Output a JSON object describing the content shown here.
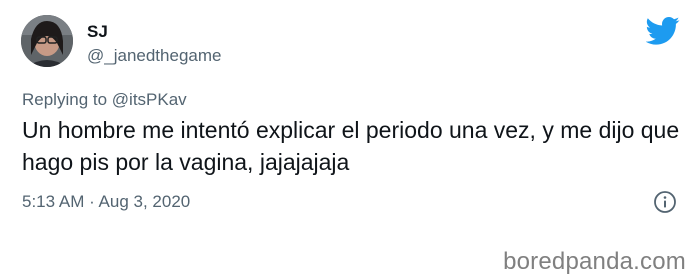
{
  "tweet": {
    "display_name": "SJ",
    "handle": "@_janedthegame",
    "reply_prefix": "Replying to",
    "reply_to": "@itsPKav",
    "text": "Un hombre me intentó explicar el periodo una vez, y me dijo que hago pis por la vagina, jajajajaja",
    "timestamp": "5:13 AM · Aug 3, 2020",
    "logo_icon": "twitter-bird-icon",
    "info_icon": "info-icon",
    "brand_color": "#1d9bf0"
  },
  "watermark": "boredpanda.com"
}
